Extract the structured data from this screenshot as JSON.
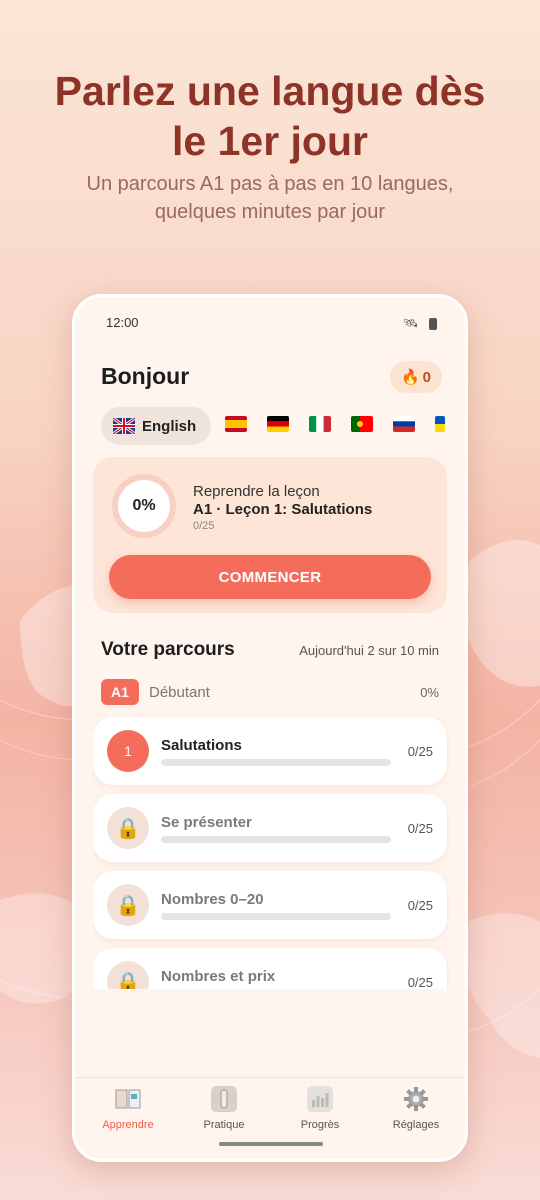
{
  "promo": {
    "headline_line1": "Parlez une langue dès",
    "headline_line2": "le 1er jour",
    "subline_line1": "Un parcours A1 pas à pas en 10 langues,",
    "subline_line2": "quelques minutes par jour"
  },
  "status_bar": {
    "time": "12:00"
  },
  "header": {
    "greeting": "Bonjour",
    "streak_count": "0",
    "streak_icon": "flame-icon"
  },
  "languages": {
    "active": {
      "label": "English",
      "flag": "flag-uk"
    },
    "others": [
      "flag-es",
      "flag-de",
      "flag-it",
      "flag-pt",
      "flag-ru",
      "flag-ua"
    ]
  },
  "resume": {
    "progress_text": "0%",
    "progress_value": 0,
    "label": "Reprendre la leçon",
    "title": "A1 · Leçon 1: Salutations",
    "count": "0/25",
    "button": "COMMENCER"
  },
  "path": {
    "title": "Votre parcours",
    "today": "Aujourd'hui 2 sur 10 min",
    "level_code": "A1",
    "level_name": "Débutant",
    "level_pct": "0%"
  },
  "lessons": [
    {
      "badge": "1",
      "title": "Salutations",
      "count": "0/25",
      "locked": false,
      "progress": 0
    },
    {
      "badge": "🔒",
      "title": "Se présenter",
      "count": "0/25",
      "locked": true,
      "progress": 0
    },
    {
      "badge": "🔒",
      "title": "Nombres 0–20",
      "count": "0/25",
      "locked": true,
      "progress": 0
    },
    {
      "badge": "🔒",
      "title": "Nombres et prix",
      "count": "0/25",
      "locked": true,
      "progress": 0
    }
  ],
  "tabs": [
    {
      "label": "Apprendre",
      "icon": "book-icon",
      "active": true
    },
    {
      "label": "Pratique",
      "icon": "practice-icon",
      "active": false
    },
    {
      "label": "Progrès",
      "icon": "chart-icon",
      "active": false
    },
    {
      "label": "Réglages",
      "icon": "gear-icon",
      "active": false
    }
  ],
  "colors": {
    "accent": "#f46d5a",
    "headline": "#8e3328",
    "subline": "#9a6a5c"
  }
}
